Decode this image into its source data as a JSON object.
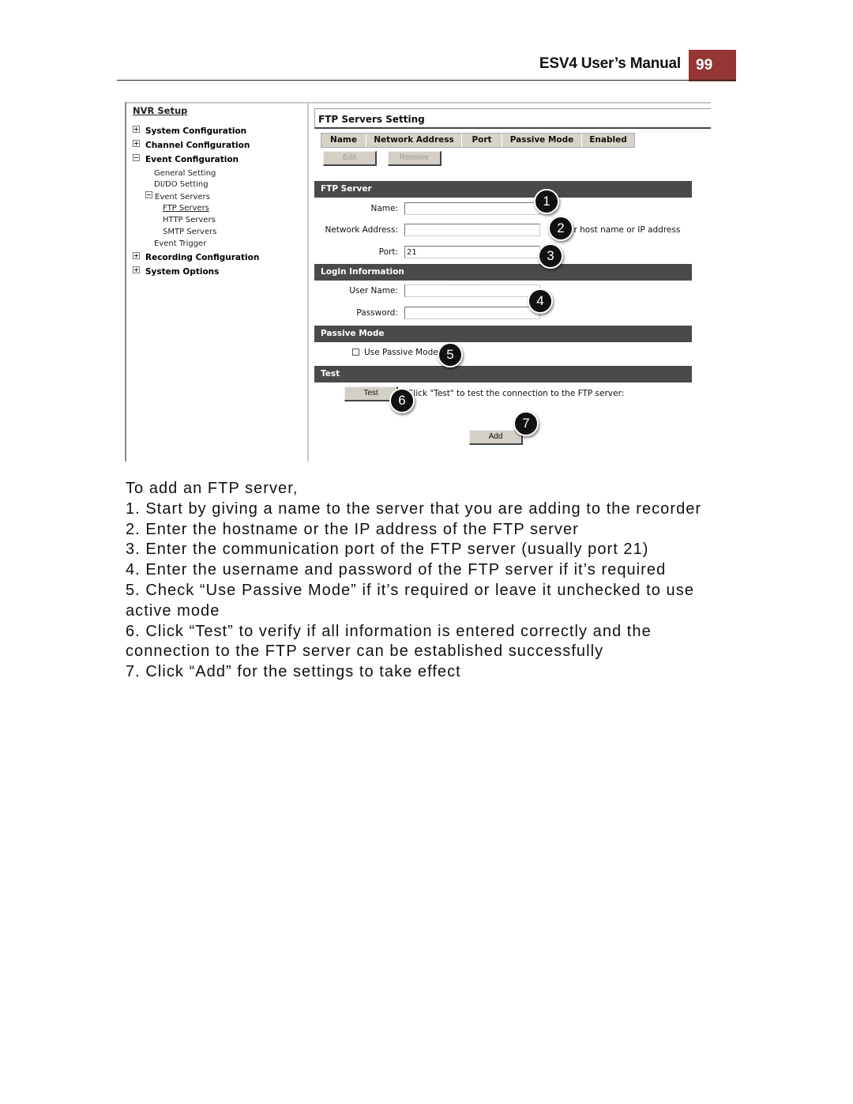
{
  "header": {
    "manual_title": "ESV4 User’s Manual",
    "page_number": "99",
    "accent_color": "#943634"
  },
  "sidebar": {
    "title": "NVR Setup",
    "items": [
      {
        "label": "System Configuration",
        "icon": "plus-box-icon",
        "level": 0
      },
      {
        "label": "Channel Configuration",
        "icon": "plus-box-icon",
        "level": 0
      },
      {
        "label": "Event Configuration",
        "icon": "minus-box-icon",
        "level": 0
      },
      {
        "label": "General Setting",
        "level": 1
      },
      {
        "label": "DI/DO Setting",
        "level": 1
      },
      {
        "label": "Event Servers",
        "icon": "minus-box-icon",
        "level": 1
      },
      {
        "label": "FTP Servers",
        "level": 2,
        "selected": true
      },
      {
        "label": "HTTP Servers",
        "level": 2
      },
      {
        "label": "SMTP Servers",
        "level": 2
      },
      {
        "label": "Event Trigger",
        "level": 1
      },
      {
        "label": "Recording Configuration",
        "icon": "plus-box-icon",
        "level": 0
      },
      {
        "label": "System Options",
        "icon": "plus-box-icon",
        "level": 0
      }
    ]
  },
  "main": {
    "section_title": "FTP Servers Setting",
    "table_columns": [
      "Name",
      "Network Address",
      "Port",
      "Passive Mode",
      "Enabled"
    ],
    "edit_label": "Edit",
    "remove_label": "Remove",
    "ftp_server": {
      "header": "FTP Server",
      "name_label": "Name:",
      "name_value": "",
      "address_label": "Network Address:",
      "address_value": "",
      "address_hint": "er host name or IP address",
      "port_label": "Port:",
      "port_value": "21"
    },
    "login": {
      "header": "Login Information",
      "username_label": "User Name:",
      "username_value": "",
      "password_label": "Password:",
      "password_value": ""
    },
    "passive": {
      "header": "Passive Mode",
      "checkbox_label": "Use Passive Mode",
      "checked": false
    },
    "test": {
      "header": "Test",
      "button_label": "Test",
      "hint": "Click \"Test\" to test the connection to the FTP server:"
    },
    "add_label": "Add"
  },
  "callouts": [
    "1",
    "2",
    "3",
    "4",
    "5",
    "6",
    "7"
  ],
  "instructions": {
    "intro": "To add an FTP server,",
    "steps": [
      "1. Start by giving a name to the server that you are adding to the recorder",
      "2. Enter the hostname or the IP address of the FTP server",
      "3. Enter the communication port of the FTP server (usually port 21)",
      "4. Enter the username and password of the FTP server if it’s required",
      "5. Check “Use Passive Mode” if it’s required or leave it unchecked to use active mode",
      "6. Click “Test” to verify if all information is entered correctly and the connection to the FTP server can be established successfully",
      "7. Click “Add” for the settings to take effect"
    ]
  }
}
